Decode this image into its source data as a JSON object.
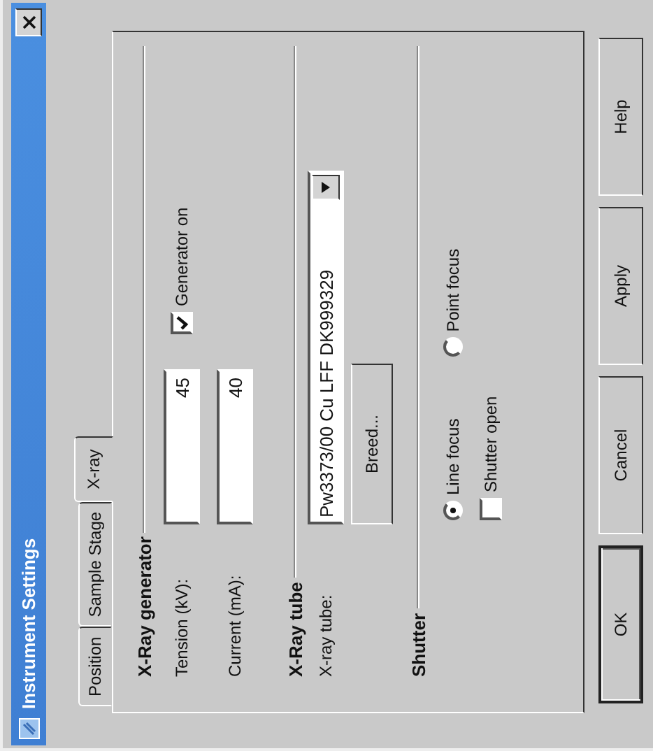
{
  "window": {
    "title": "Instrument Settings"
  },
  "tabs": [
    {
      "label": "Position",
      "selected": false
    },
    {
      "label": "Sample Stage",
      "selected": false
    },
    {
      "label": "X-ray",
      "selected": true
    }
  ],
  "generator": {
    "heading": "X-Ray generator",
    "fields": [
      {
        "label": "Tension (kV):",
        "value": "45"
      },
      {
        "label": "Current (mA):",
        "value": "40"
      }
    ],
    "checkbox": {
      "label": "Generator on",
      "checked": true
    }
  },
  "tube": {
    "heading": "X-Ray tube",
    "label": "X-ray tube:",
    "value": "Pw3373/00 Cu LFF DK999329",
    "button": "Breed..."
  },
  "shutter": {
    "heading": "Shutter",
    "focus_options": [
      {
        "label": "Line focus",
        "selected": true
      },
      {
        "label": "Point focus",
        "selected": false
      }
    ],
    "checkbox": {
      "label": "Shutter open",
      "checked": false
    }
  },
  "buttons": [
    {
      "label": "OK",
      "default": true
    },
    {
      "label": "Cancel",
      "default": false
    },
    {
      "label": "Apply",
      "default": false
    },
    {
      "label": "Help",
      "default": false
    }
  ]
}
